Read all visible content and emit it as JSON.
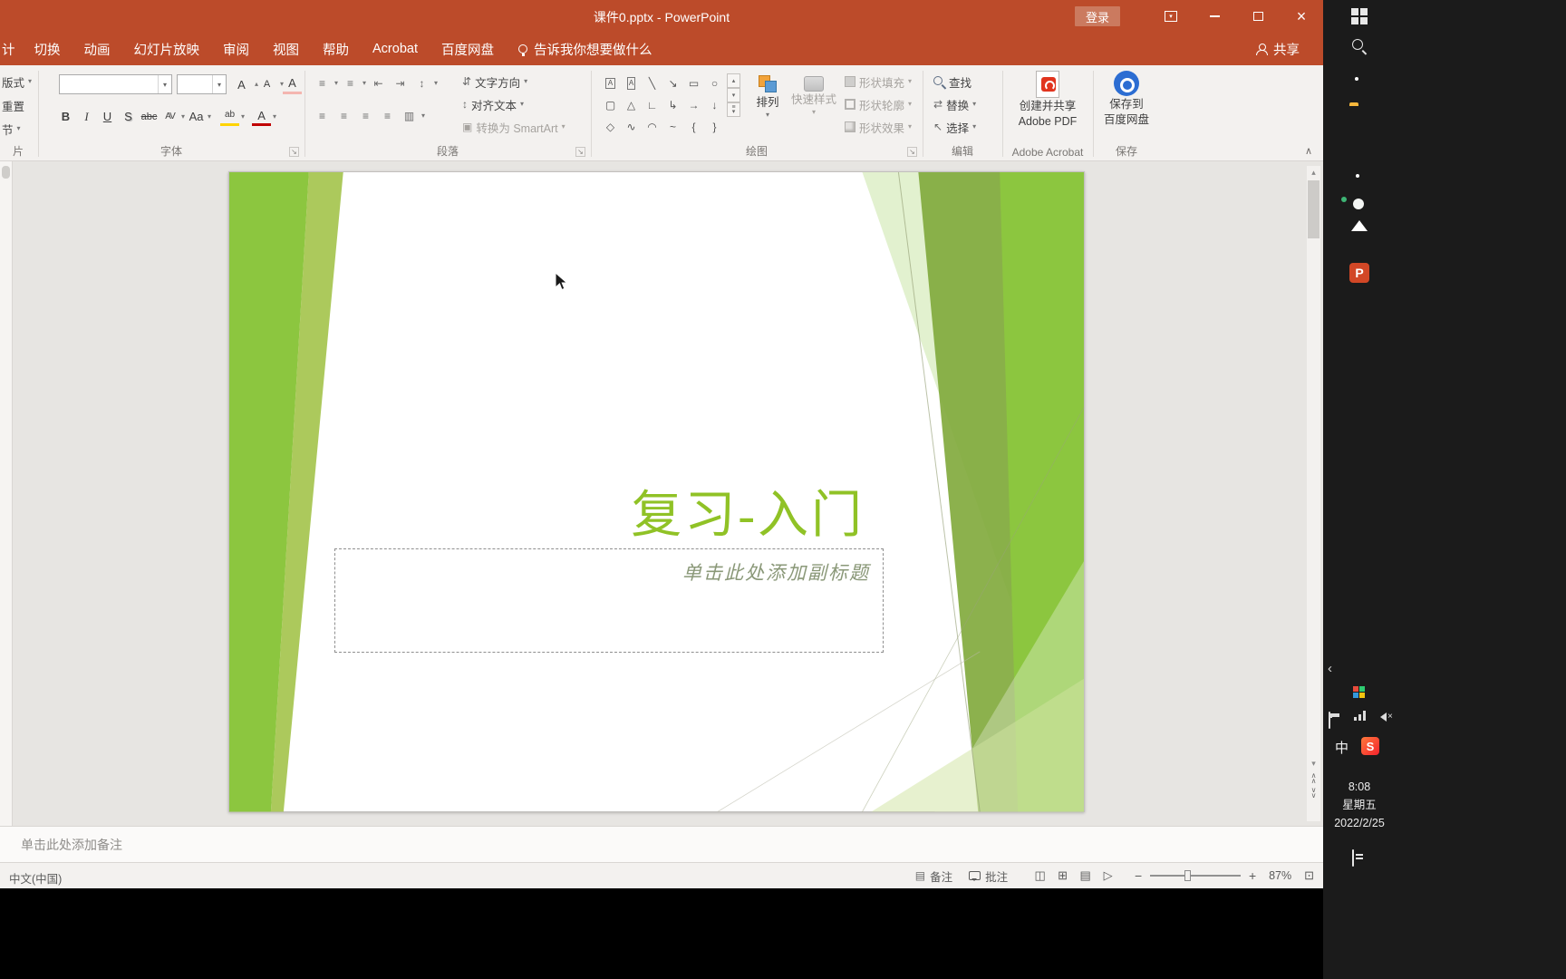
{
  "colors": {
    "titlebar_red": "#bc4b2a",
    "accent_green": "#90c226",
    "slide_green": "#8cc63f",
    "ribbon_bg": "#f3f1ef",
    "taskbar_bg": "#1b1b1b"
  },
  "titlebar": {
    "title": "课件0.pptx - PowerPoint",
    "sign_in": "登录"
  },
  "tabs": {
    "partial": "计",
    "list": [
      "切换",
      "动画",
      "幻灯片放映",
      "审阅",
      "视图",
      "帮助",
      "Acrobat",
      "百度网盘"
    ],
    "tell_me": "告诉我你想要做什么",
    "share": "共享"
  },
  "ribbon": {
    "slides_group": {
      "layout": "版式",
      "reset": "重置",
      "section": "节",
      "label": "片"
    },
    "font_group": {
      "label": "字体",
      "font_name": "",
      "font_size": "",
      "bold": "B",
      "italic": "I",
      "underline": "U",
      "shadow": "S",
      "strike": "abc",
      "spacing": "AV",
      "case": "Aa",
      "highlight": "ab",
      "color": "A",
      "grow": "A",
      "shrink": "A"
    },
    "paragraph_group": {
      "label": "段落",
      "text_direction": "文字方向",
      "align_text": "对齐文本",
      "smartart": "转换为 SmartArt"
    },
    "drawing_group": {
      "label": "绘图",
      "arrange": "排列",
      "quick_styles": "快速样式",
      "shape_fill": "形状填充",
      "shape_outline": "形状轮廓",
      "shape_effects": "形状效果"
    },
    "editing_group": {
      "label": "编辑",
      "find": "查找",
      "replace": "替换",
      "select": "选择"
    },
    "acrobat_group": {
      "label": "Adobe Acrobat",
      "line1": "创建并共享",
      "line2": "Adobe PDF"
    },
    "save_group": {
      "label": "保存",
      "line1": "保存到",
      "line2": "百度网盘"
    }
  },
  "slide": {
    "title": "复习-入门",
    "subtitle": "单击此处添加副标题"
  },
  "notes": {
    "placeholder": "单击此处添加备注"
  },
  "statusbar": {
    "language": "中文(中国)",
    "notes": "备注",
    "comments": "批注",
    "zoom": "87%"
  },
  "taskbar": {
    "ime": "中",
    "sogou": "S",
    "time": "8:08",
    "weekday": "星期五",
    "date": "2022/2/25"
  },
  "icons": {
    "dropdown": "▾",
    "up": "▴",
    "down": "▾",
    "collapse": "∧",
    "launcher": "↘",
    "close": "×",
    "minus": "−",
    "plus": "+",
    "fit": "⊡",
    "bullets": "≡",
    "numbering": "≡",
    "indent_dec": "⇤",
    "indent_inc": "⇥",
    "line_spacing": "↕",
    "align": "≡",
    "columns": "▥",
    "text_direction": "⇵",
    "align_text": "↕",
    "smartart": "▣",
    "replace": "⇄",
    "select": "↖",
    "more": "≡",
    "chev_up": "∧",
    "chev_down": "∨",
    "notes_icon": "▤",
    "views": [
      "◫",
      "⊞",
      "▤",
      "▷"
    ],
    "shapes": [
      "A",
      "A",
      "╲",
      "↘",
      "▭",
      "○",
      "▢",
      "△",
      "∟",
      "↳",
      "→",
      "↓",
      "◇",
      "∿",
      "◠",
      "~",
      "{",
      "}"
    ]
  }
}
